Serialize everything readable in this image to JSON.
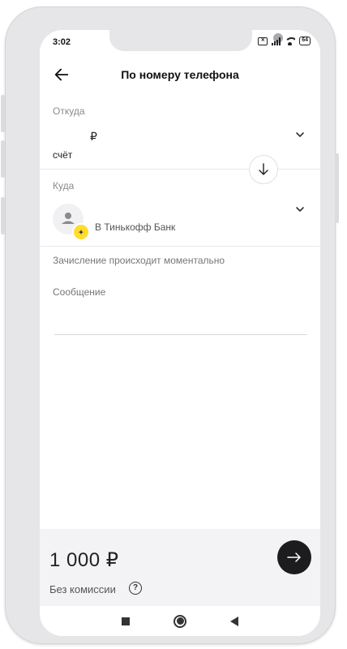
{
  "status_bar": {
    "time": "3:02",
    "battery": "64"
  },
  "header": {
    "title": "По номеру телефона"
  },
  "from_section": {
    "label": "Откуда",
    "currency_symbol": "₽",
    "account_text": "счёт"
  },
  "to_section": {
    "label": "Куда",
    "bank_text": "В Тинькофф Банк"
  },
  "info": {
    "text": "Зачисление происходит моментально"
  },
  "message": {
    "label": "Сообщение"
  },
  "bottom": {
    "amount": "1 000 ₽",
    "fee": "Без комиссии",
    "help": "?"
  },
  "colors": {
    "accent_yellow": "#ffdd2d",
    "next_button": "#1c1c1e"
  },
  "icons": {
    "back": "arrow-left-icon",
    "swap": "arrow-down-icon",
    "next": "arrow-right-icon",
    "help": "question-circle-icon"
  }
}
